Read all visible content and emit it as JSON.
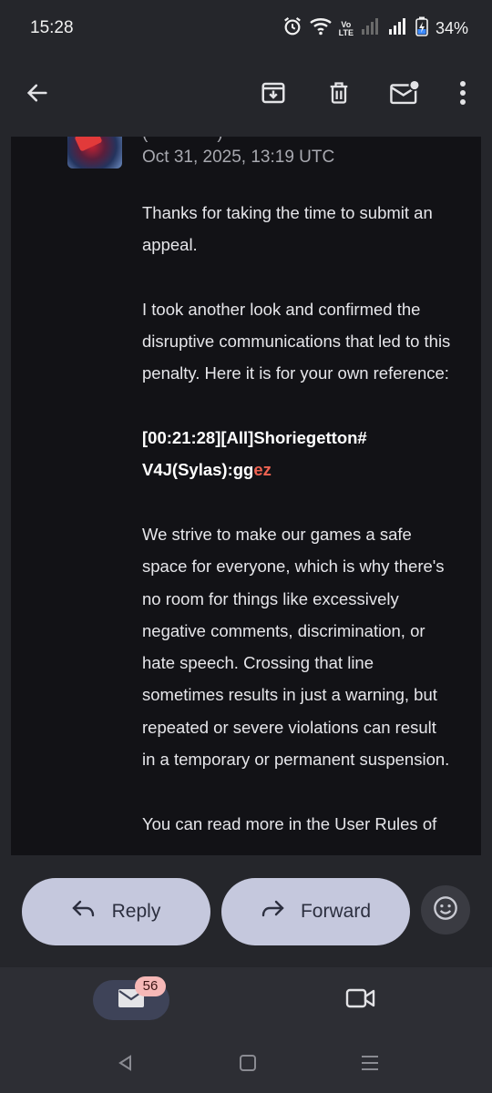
{
  "status_bar": {
    "time": "15:28",
    "network_label": "Vo\nLTE",
    "battery_text": "34%"
  },
  "toolbar": {
    "back_icon": "arrow-left-icon",
    "archive_icon": "archive-icon",
    "delete_icon": "trash-icon",
    "unread_icon": "mark-unread-icon",
    "more_icon": "more-vert-icon"
  },
  "message": {
    "sender_partial": "(                    )",
    "date": "Oct 31, 2025, 13:19 UTC",
    "paragraph_1": "Thanks for taking the time to submit an appeal.",
    "paragraph_2": "I took another look and confirmed the disruptive communications that led to this penalty. Here it is for your own reference:",
    "chat_log_prefix": "[00:21:28][All]Shoriegetton# V4J(Sylas):gg",
    "chat_log_highlight": "ez",
    "paragraph_3": "We strive to make our games a safe space for everyone, which is why there's no room for things like excessively negative comments, discrimination, or hate speech. Crossing that line sometimes results in just a warning, but repeated or severe violations can result in a temporary or permanent suspension.",
    "paragraph_4_cut": "You can read more in the User Rules of"
  },
  "actions": {
    "reply_label": "Reply",
    "forward_label": "Forward",
    "reply_icon": "reply-arrow-icon",
    "forward_icon": "forward-arrow-icon",
    "emoji_icon": "emoji-icon"
  },
  "bottom_nav": {
    "mail_badge": "56",
    "mail_icon": "mail-icon",
    "meet_icon": "video-camera-icon"
  },
  "colors": {
    "background": "#25262b",
    "message_bg": "#121216",
    "button_bg": "#c5c8dd",
    "highlight": "#ee6352",
    "badge": "#f6b8b7"
  }
}
